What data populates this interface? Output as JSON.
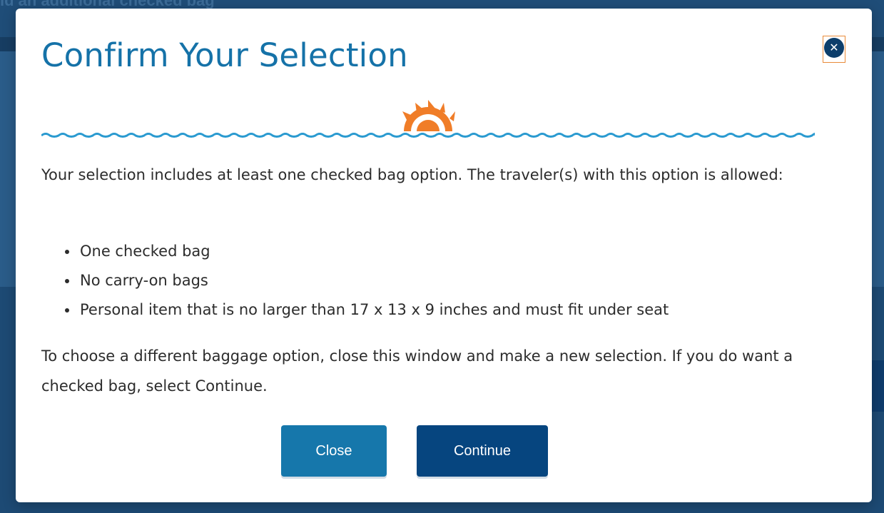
{
  "background": {
    "heading_fragment": "ıd an additional checked bag"
  },
  "modal": {
    "title": "Confirm Your Selection",
    "close_icon": "close-icon",
    "paragraph_1": "Your selection includes at least one checked bag option. The traveler(s) with this option is allowed:",
    "allowances": [
      "One checked bag",
      "No carry-on bags",
      "Personal item that is no larger than 17 x 13 x 9 inches and must fit under seat"
    ],
    "paragraph_2": "To choose a different baggage option, close this window and make a new selection. If you do want a checked bag, select Continue.",
    "close_button_label": "Close",
    "continue_button_label": "Continue"
  },
  "colors": {
    "title": "#1572a8",
    "wave": "#2a9ad0",
    "sun": "#f07d28",
    "close_button": "#1677ab",
    "continue_button": "#06457f",
    "close_icon": "#0d3e6b"
  }
}
